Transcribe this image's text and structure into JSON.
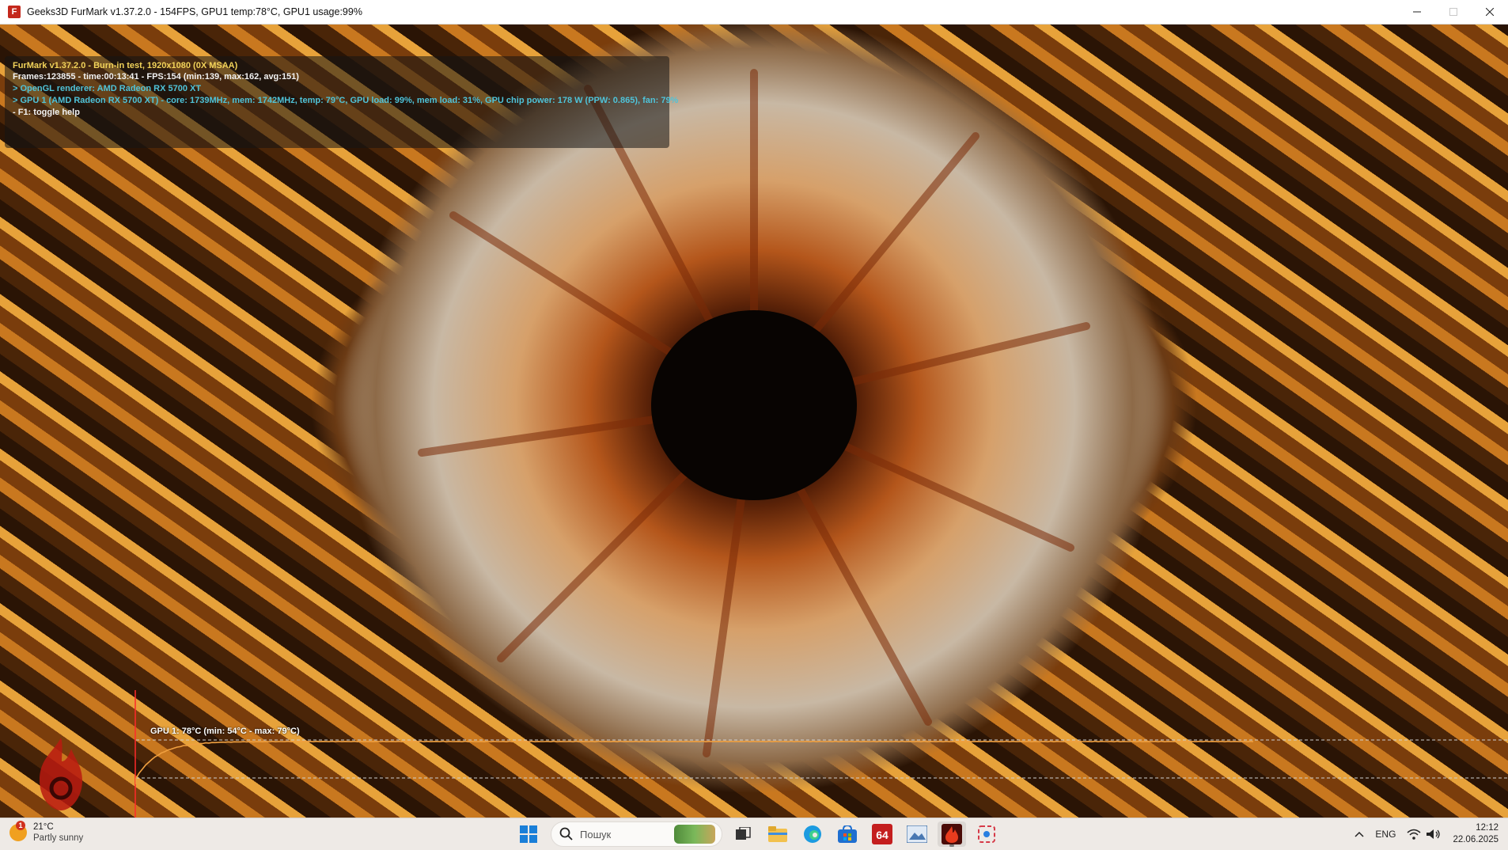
{
  "window": {
    "title": "Geeks3D FurMark v1.37.2.0 - 154FPS, GPU1 temp:78°C, GPU1 usage:99%",
    "icon": "furmark-icon",
    "controls": [
      "minimize-icon",
      "maximize-icon",
      "close-icon"
    ]
  },
  "overlay": {
    "line1": "FurMark v1.37.2.0 - Burn-in test, 1920x1080 (0X MSAA)",
    "line2": "Frames:123855 - time:00:13:41 - FPS:154 (min:139, max:162, avg:151)",
    "line3": "> OpenGL renderer: AMD Radeon RX 5700 XT",
    "line4": "> GPU 1 (AMD Radeon RX 5700 XT) - core: 1739MHz, mem: 1742MHz, temp: 79°C, GPU load: 99%, mem load: 31%, GPU chip power: 178 W (PPW: 0.865), fan: 79%",
    "line5": "- F1: toggle help",
    "colors": {
      "yellow": "#f2d35a",
      "white": "#f2f2f2",
      "cyan": "#4fc3d9"
    }
  },
  "graph": {
    "label": "GPU 1: 78°C (min: 54°C - max: 79°C)",
    "min_c": 54,
    "max_c": 79,
    "current_c": 78,
    "line_color": "#f0a040"
  },
  "taskbar": {
    "weather": {
      "temp": "21°C",
      "desc": "Partly sunny",
      "badge": "1"
    },
    "search": {
      "placeholder": "Пошук"
    },
    "apps": [
      "task-view-icon",
      "file-explorer-icon",
      "edge-icon",
      "store-icon",
      "aida64-icon",
      "photos-icon",
      "furmark-icon",
      "snipping-tool-icon"
    ],
    "tray": {
      "chevron": "^",
      "lang": "ENG"
    },
    "clock": {
      "time": "12:12",
      "date": "22.06.2025"
    }
  }
}
